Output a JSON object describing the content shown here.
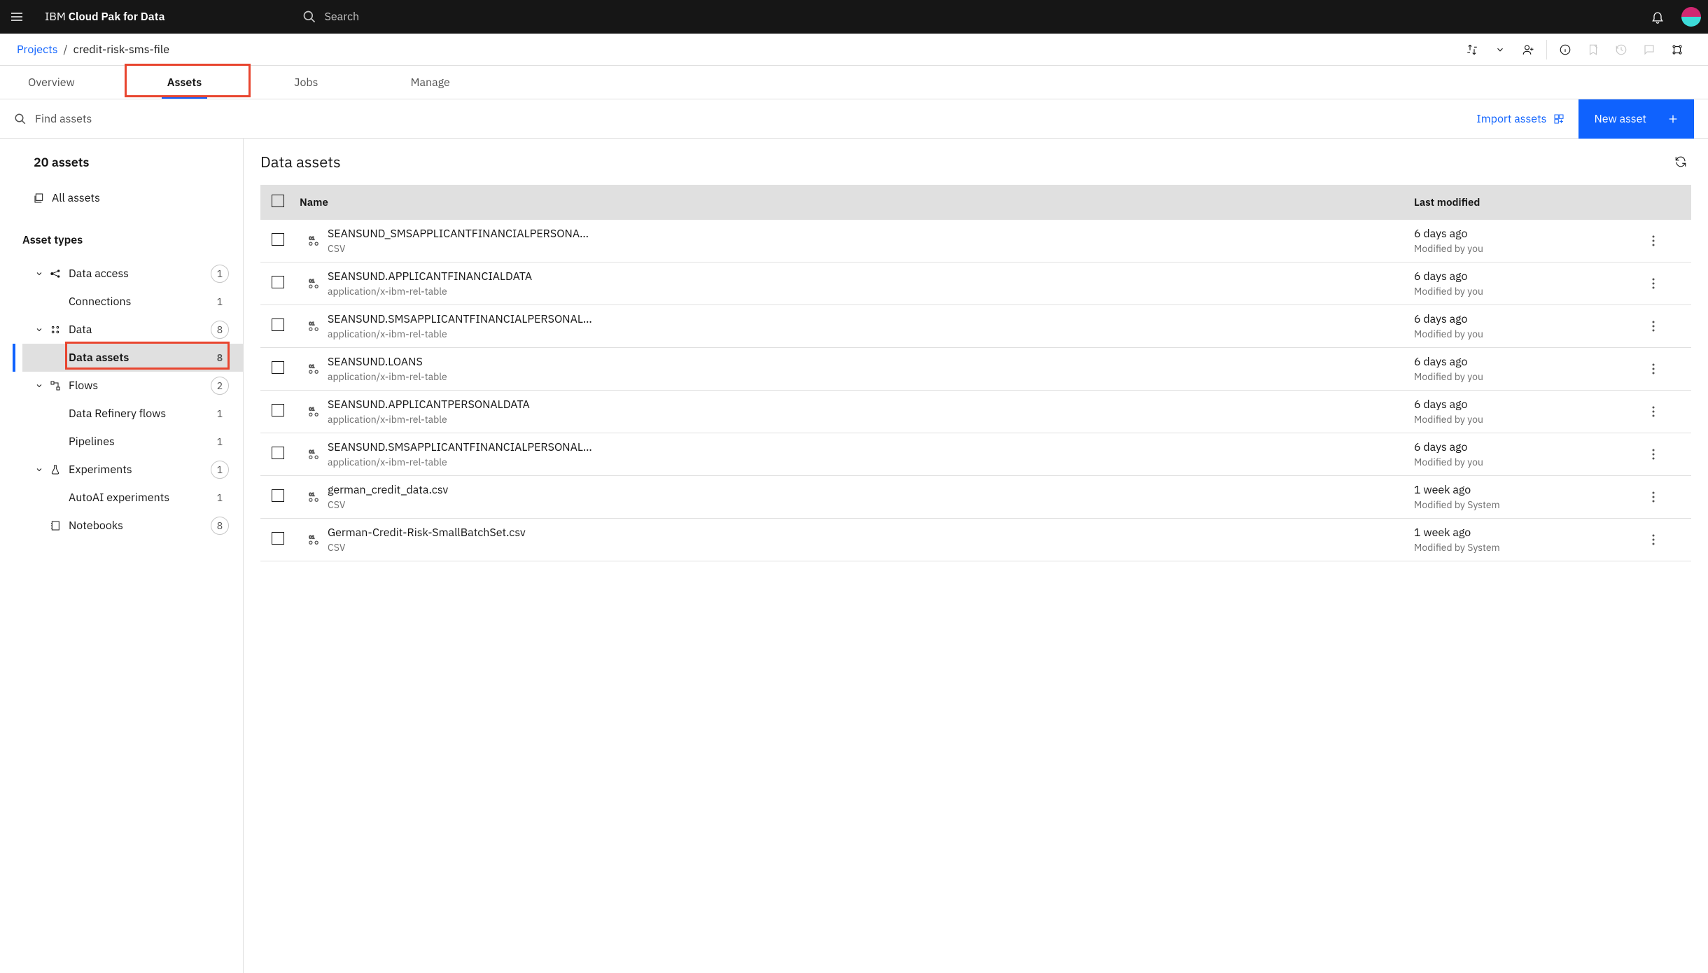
{
  "brand": {
    "prefix": "IBM",
    "strong": "Cloud Pak for Data"
  },
  "search": {
    "placeholder": "Search"
  },
  "breadcrumb": {
    "root": "Projects",
    "sep": "/",
    "current": "credit-risk-sms-file"
  },
  "tabs": {
    "overview": "Overview",
    "assets": "Assets",
    "jobs": "Jobs",
    "manage": "Manage"
  },
  "toolbar": {
    "find_placeholder": "Find assets",
    "import": "Import assets",
    "new_asset": "New asset"
  },
  "sidebar": {
    "summary": "20 assets",
    "all": "All assets",
    "types_label": "Asset types",
    "tree": {
      "data_access": {
        "label": "Data access",
        "count": "1"
      },
      "connections": {
        "label": "Connections",
        "count": "1"
      },
      "data": {
        "label": "Data",
        "count": "8"
      },
      "data_assets": {
        "label": "Data assets",
        "count": "8"
      },
      "flows": {
        "label": "Flows",
        "count": "2"
      },
      "refinery": {
        "label": "Data Refinery flows",
        "count": "1"
      },
      "pipelines": {
        "label": "Pipelines",
        "count": "1"
      },
      "experiments": {
        "label": "Experiments",
        "count": "1"
      },
      "autoai": {
        "label": "AutoAI experiments",
        "count": "1"
      },
      "notebooks": {
        "label": "Notebooks",
        "count": "8"
      }
    }
  },
  "content": {
    "title": "Data assets",
    "columns": {
      "name": "Name",
      "modified": "Last modified"
    },
    "rows": [
      {
        "name": "SEANSUND_SMSAPPLICANTFINANCIALPERSONALLO...",
        "sub": "CSV",
        "time": "6 days ago",
        "by": "Modified by you"
      },
      {
        "name": "SEANSUND.APPLICANTFINANCIALDATA",
        "sub": "application/x-ibm-rel-table",
        "time": "6 days ago",
        "by": "Modified by you"
      },
      {
        "name": "SEANSUND.SMSAPPLICANTFINANCIALPERSONALLOA...",
        "sub": "application/x-ibm-rel-table",
        "time": "6 days ago",
        "by": "Modified by you"
      },
      {
        "name": "SEANSUND.LOANS",
        "sub": "application/x-ibm-rel-table",
        "time": "6 days ago",
        "by": "Modified by you"
      },
      {
        "name": "SEANSUND.APPLICANTPERSONALDATA",
        "sub": "application/x-ibm-rel-table",
        "time": "6 days ago",
        "by": "Modified by you"
      },
      {
        "name": "SEANSUND.SMSAPPLICANTFINANCIALPERSONALDATA",
        "sub": "application/x-ibm-rel-table",
        "time": "6 days ago",
        "by": "Modified by you"
      },
      {
        "name": "german_credit_data.csv",
        "sub": "CSV",
        "time": "1 week ago",
        "by": "Modified by System"
      },
      {
        "name": "German-Credit-Risk-SmallBatchSet.csv",
        "sub": "CSV",
        "time": "1 week ago",
        "by": "Modified by System"
      }
    ]
  }
}
